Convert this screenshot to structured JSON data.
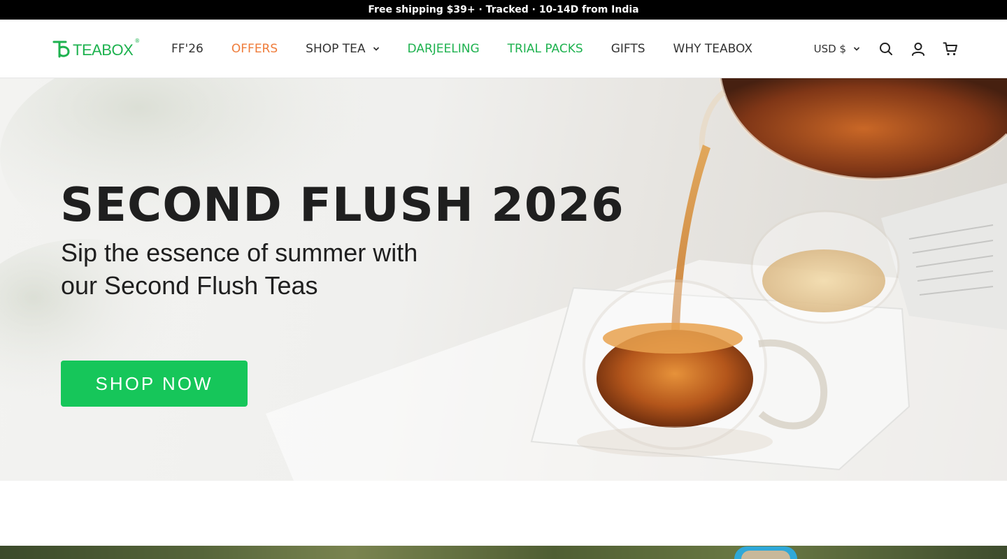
{
  "announcement": {
    "text": "Free shipping $39+ · Tracked · 10-14D from India"
  },
  "header": {
    "logo_text": "TEABOX",
    "logo_reg": "®",
    "nav": [
      {
        "label": "FF'26",
        "style": "default"
      },
      {
        "label": "OFFERS",
        "style": "orange"
      },
      {
        "label": "SHOP TEA",
        "style": "default",
        "has_dropdown": true
      },
      {
        "label": "DARJEELING",
        "style": "green"
      },
      {
        "label": "TRIAL PACKS",
        "style": "green"
      },
      {
        "label": "GIFTS",
        "style": "default"
      },
      {
        "label": "WHY TEABOX",
        "style": "default"
      }
    ],
    "currency": "USD $",
    "icons": [
      "search-icon",
      "account-icon",
      "cart-icon"
    ]
  },
  "hero": {
    "title": "SECOND FLUSH 2026",
    "subtitle_line1": "Sip the essence of summer with",
    "subtitle_line2": "our Second Flush Teas",
    "cta_label": "SHOP NOW"
  },
  "colors": {
    "brand_green": "#1eb24f",
    "cta_green": "#16c65a",
    "offers_orange": "#ef7c3a",
    "announcement_bg": "#000000"
  }
}
